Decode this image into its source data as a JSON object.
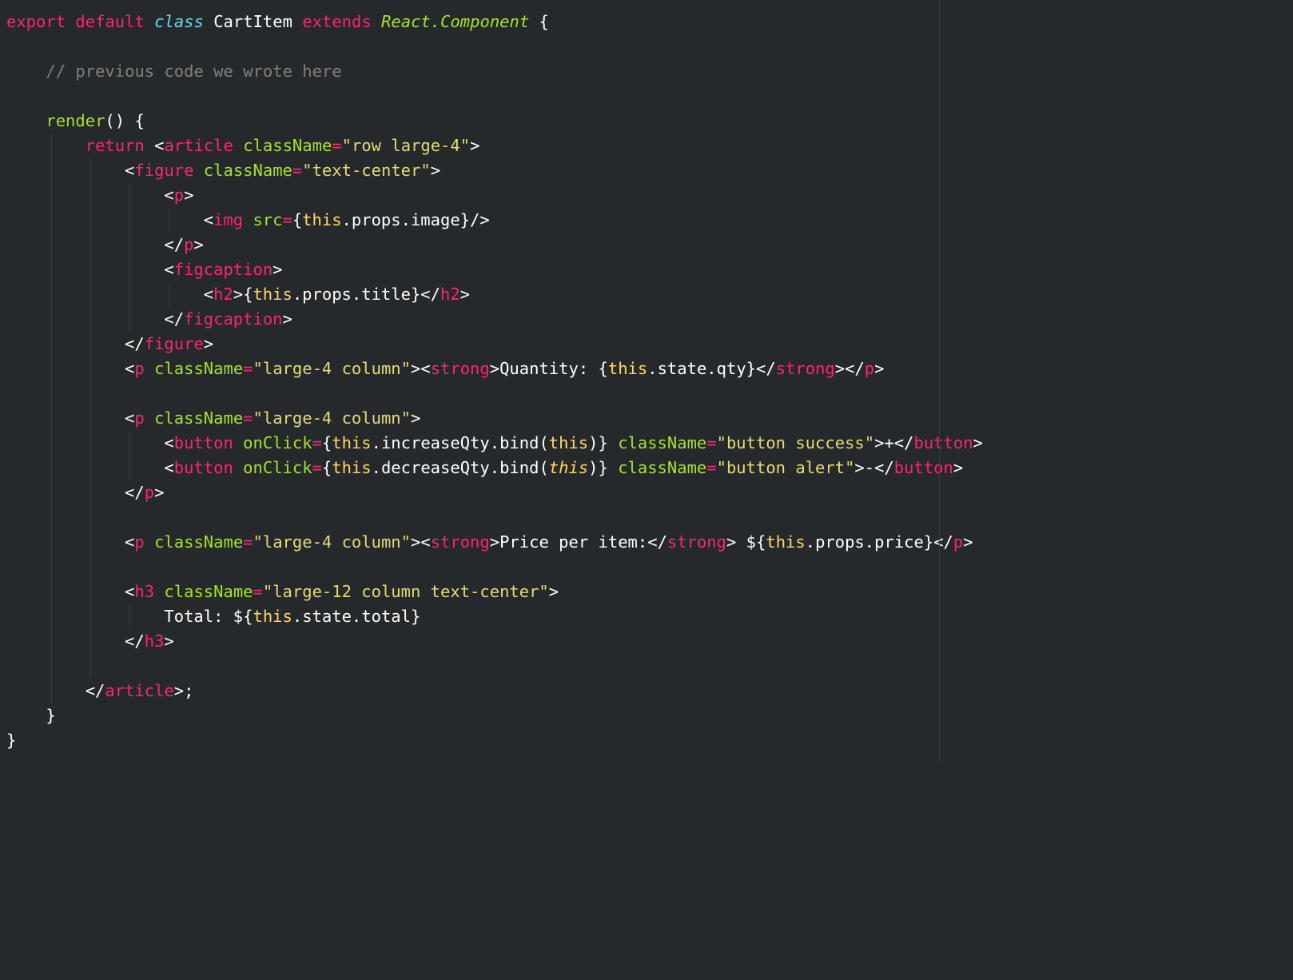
{
  "tokens": {
    "kw_export": "export",
    "kw_default": "default",
    "kw_class": "class",
    "cls_name": "CartItem",
    "kw_extends": "extends",
    "inherit": "React.Component",
    "brace_open": "{",
    "brace_close": "}",
    "comment_prev": "// previous code we wrote here",
    "fn_render": "render",
    "parens": "()",
    "kw_return": "return",
    "lt": "<",
    "gt": ">",
    "slash": "/",
    "tag_article": "article",
    "tag_figure": "figure",
    "tag_p": "p",
    "tag_img": "img",
    "tag_figcaption": "figcaption",
    "tag_h2": "h2",
    "tag_strong": "strong",
    "tag_button": "button",
    "tag_h3": "h3",
    "attr_className": "className",
    "attr_src": "src",
    "attr_onClick": "onClick",
    "eq": "=",
    "str_row_large4": "\"row large-4\"",
    "str_text_center": "\"text-center\"",
    "str_large4_column": "\"large-4 column\"",
    "str_button_success": "\"button success\"",
    "str_button_alert": "\"button alert\"",
    "str_large12_column_textcenter": "\"large-12 column text-center\"",
    "jsx_open": "{",
    "jsx_close": "}",
    "kw_this": "this",
    "dot": ".",
    "prop_props": "props",
    "prop_image": "image",
    "prop_title": "title",
    "prop_state": "state",
    "prop_qty": "qty",
    "prop_price": "price",
    "prop_total": "total",
    "fn_increaseQty": "increaseQty",
    "fn_decreaseQty": "decreaseQty",
    "fn_bind": "bind",
    "paren_open": "(",
    "paren_close": ")",
    "selfclose": "/>",
    "txt_quantity": "Quantity: ",
    "txt_price_per_item": "Price per item:",
    "txt_plus": "+",
    "txt_minus": "-",
    "txt_dollar": " $",
    "txt_total": "Total: $",
    "semi": ";"
  }
}
